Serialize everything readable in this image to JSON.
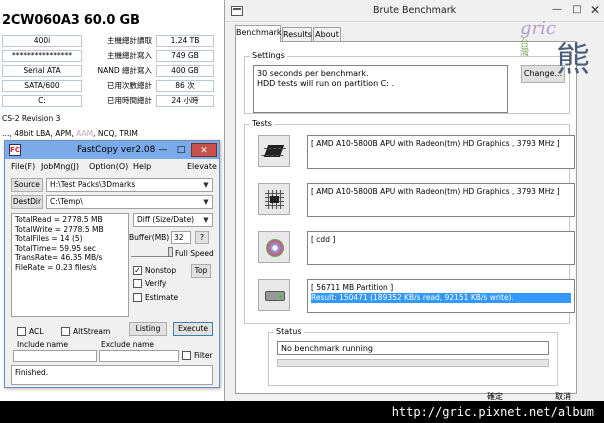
{
  "crystaldiskinfo": {
    "title": "2CW060A3  60.0 GB",
    "rows": [
      {
        "left": "400i",
        "label": "主機總計讀取",
        "value": "1.24 TB"
      },
      {
        "left": "****************",
        "label": "主機總計寫入",
        "value": "749 GB"
      },
      {
        "left": "Serial ATA",
        "label": "NAND 總計寫入",
        "value": "400 GB"
      },
      {
        "left": "SATA/600",
        "label": "已用次數總計",
        "value": "86 次"
      },
      {
        "left": "C:",
        "label": "已用時間總計",
        "value": "24 小時"
      }
    ],
    "standard": "CS-2 Revision 3",
    "features_prefix": "…, 48bit LBA, APM, ",
    "features_dim": "AAM",
    "features_suffix": ", NCQ, TRIM"
  },
  "brute": {
    "title": "Brute Benchmark",
    "tabs": [
      "Benchmark",
      "Results",
      "About"
    ],
    "settings_label": "Settings",
    "settings_line1": "30 seconds per benchmark.",
    "settings_line2": "HDD tests will run on partition C: .",
    "change_button": "Change...",
    "tests_label": "Tests",
    "tests": [
      {
        "text": "[ AMD A10-5800B APU with Radeon(tm) HD Graphics  , 3793 MHz ]",
        "icon": "cpu-chip-icon",
        "result": ""
      },
      {
        "text": "[ AMD A10-5800B APU with Radeon(tm) HD Graphics  , 3793 MHz ]",
        "icon": "memory-grid-icon",
        "result": ""
      },
      {
        "text": "[ cdd ]",
        "icon": "cdrom-icon",
        "result": ""
      },
      {
        "text": "[ 56711 MB Partition ]",
        "icon": "hard-drive-icon",
        "result": "Result: 150471 (189352 KB/s read, 92151 KB/s  write)."
      }
    ],
    "status_label": "Status",
    "status_text": "No benchmark running",
    "bottom_left_button": "確定",
    "bottom_right_button": "取消"
  },
  "fastcopy": {
    "title": "FastCopy ver2.08",
    "icon_glyph": "FC",
    "menu": [
      "File(F)",
      "JobMng(J)",
      "Option(O)",
      "Help",
      "Elevate"
    ],
    "source_button": "Source",
    "source_value": "H:\\Test Packs\\3Dmarks",
    "destdir_button": "DestDir",
    "destdir_value": "C:\\Temp\\",
    "stats": [
      "TotalRead = 2778.5 MB",
      "TotalWrite = 2778.5 MB",
      "TotalFiles = 14 (5)",
      "TotalTime= 59.95 sec",
      "TransRate= 46.35 MB/s",
      "FileRate  = 0.23 files/s"
    ],
    "mode_value": "Diff (Size/Date)",
    "buffer_label": "Buffer(MB)",
    "buffer_value": "32",
    "buffer_help": "?",
    "full_speed_label": "Full Speed",
    "speed_level": 1.0,
    "nonstop_label": "Nonstop",
    "nonstop_checked": "✓",
    "top_button": "Top",
    "verify_label": "Verify",
    "estimate_label": "Estimate",
    "listing_button": "Listing",
    "execute_button": "Execute",
    "acl_label": "ACL",
    "altstream_label": "AltStream",
    "include_label": "Include name",
    "exclude_label": "Exclude name",
    "filter_label": "Filter",
    "status_text": "Finished."
  },
  "logo": {
    "en": "gric",
    "zh": "熊",
    "sub": "台灣"
  },
  "banner": {
    "url": "http://gric.pixnet.net/album"
  }
}
